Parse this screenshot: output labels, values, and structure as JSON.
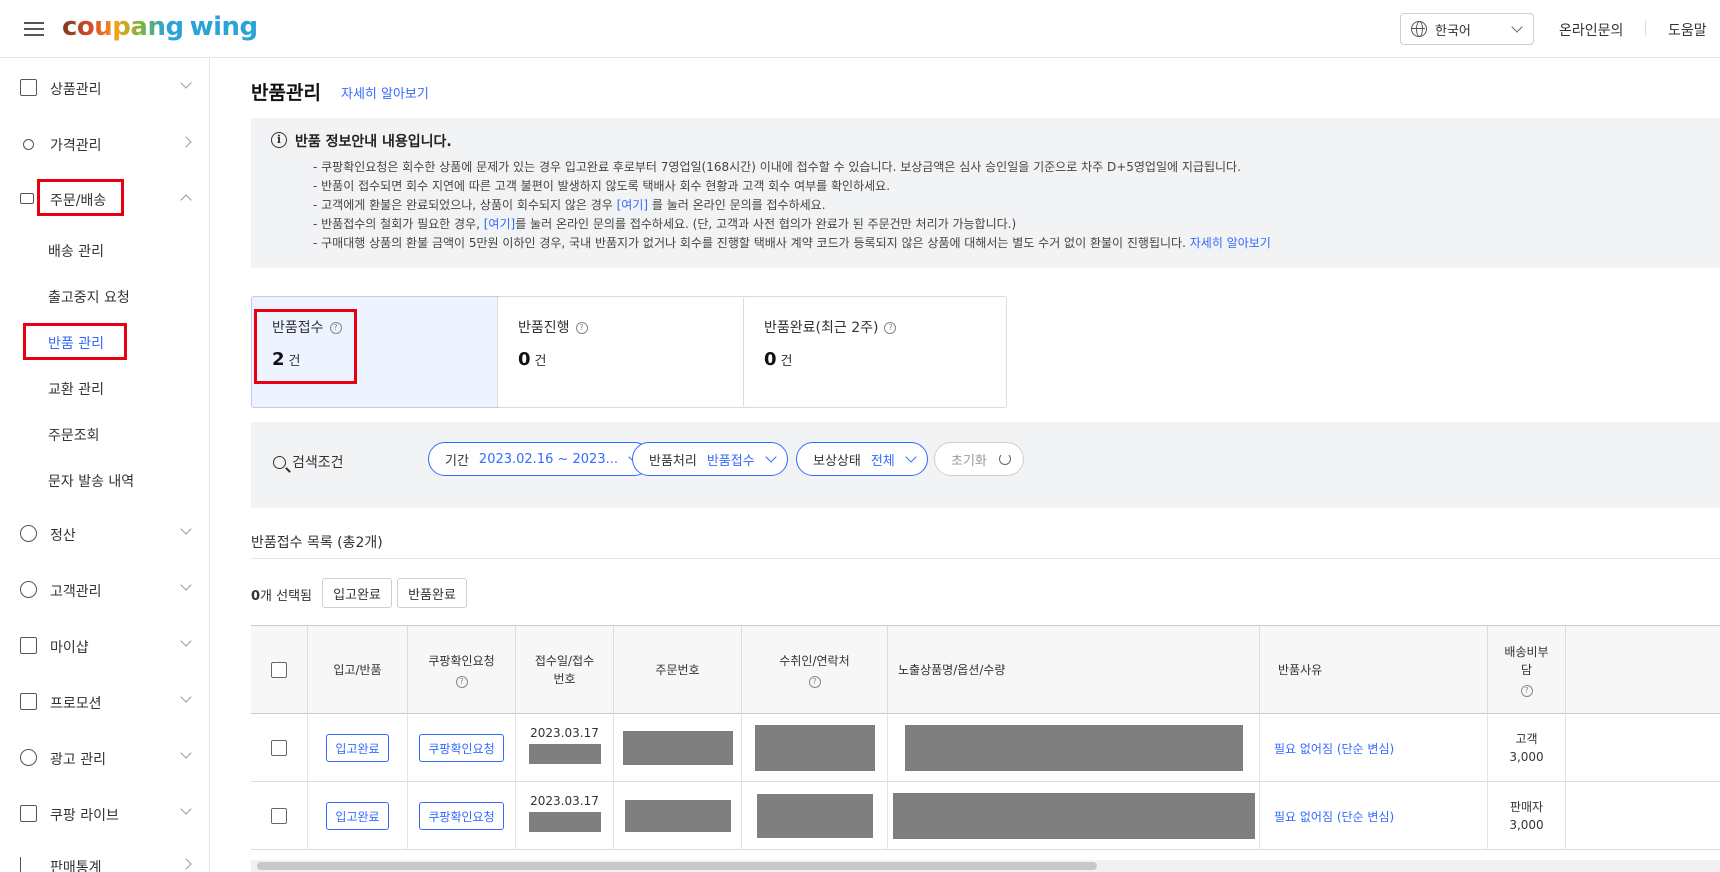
{
  "header": {
    "logo_text": "coupang",
    "logo_suffix": "wing",
    "language": "한국어",
    "links": [
      "온라인문의",
      "도움말"
    ]
  },
  "sidebar": {
    "items": [
      {
        "label": "상품관리",
        "icon": "box-icon"
      },
      {
        "label": "가격관리",
        "icon": "medal-icon"
      },
      {
        "label": "주문/배송",
        "icon": "truck-icon"
      },
      {
        "label": "정산",
        "icon": "won-icon"
      },
      {
        "label": "고객관리",
        "icon": "smile-icon"
      },
      {
        "label": "마이샵",
        "icon": "shop-icon"
      },
      {
        "label": "프로모션",
        "icon": "ticket-icon"
      },
      {
        "label": "광고 관리",
        "icon": "clock-icon"
      },
      {
        "label": "쿠팡 라이브",
        "icon": "live-icon"
      },
      {
        "label": "판매통계",
        "icon": "stats-icon"
      }
    ],
    "sub_items": [
      "배송 관리",
      "출고중지 요청",
      "반품 관리",
      "교환 관리",
      "주문조회",
      "문자 발송 내역"
    ]
  },
  "page": {
    "title": "반품관리",
    "learn_more": "자세히 알아보기"
  },
  "info": {
    "title": "반품 정보안내 내용입니다.",
    "lines": [
      {
        "pre": "- 쿠팡확인요청은 회수한 상품에 문제가 있는 경우 입고완료 후로부터 7영업일(168시간) 이내에 접수할 수 있습니다. 보상금액은 심사 승인일을 기준으로 차주 D+5영업일에 지급됩니다.",
        "link": "",
        "post": ""
      },
      {
        "pre": "- 반품이 접수되면 회수 지연에 따른 고객 불편이 발생하지 않도록 택배사 회수 현황과 고객 회수 여부를 확인하세요.",
        "link": "",
        "post": ""
      },
      {
        "pre": "- 고객에게 환불은 완료되었으나, 상품이 회수되지 않은 경우 ",
        "link": "[여기]",
        "post": " 를 눌러 온라인 문의를 접수하세요."
      },
      {
        "pre": "- 반품접수의 철회가 필요한 경우, ",
        "link": "[여기]",
        "post": "를 눌러 온라인 문의를 접수하세요. (단, 고객과 사전 협의가 완료가 된 주문건만 처리가 가능합니다.)"
      },
      {
        "pre": "- 구매대행 상품의 환불 금액이 5만원 이하인 경우, 국내 반품지가 없거나 회수를 진행할 택배사 계약 코드가 등록되지 않은 상품에 대해서는 별도 수거 없이 환불이 진행됩니다. ",
        "link": "자세히 알아보기",
        "post": ""
      }
    ]
  },
  "stats": [
    {
      "label": "반품접수",
      "count": "2",
      "unit": "건"
    },
    {
      "label": "반품진행",
      "count": "0",
      "unit": "건"
    },
    {
      "label": "반품완료(최근 2주)",
      "count": "0",
      "unit": "건"
    }
  ],
  "search": {
    "label": "검색조건",
    "filters": [
      {
        "name": "기간",
        "value": "2023.02.16 ~ 2023..."
      },
      {
        "name": "반품처리",
        "value": "반품접수"
      },
      {
        "name": "보상상태",
        "value": "전체"
      }
    ],
    "reset": "초기화"
  },
  "list": {
    "title": "반품접수 목록 (총2개)",
    "selected_count": "0",
    "selected_suffix": "개 선택됨",
    "actions": [
      "입고완료",
      "반품완료"
    ]
  },
  "table": {
    "headers": [
      "입고/반품",
      "쿠팡확인요청",
      "접수일/접수번호",
      "주문번호",
      "수취인/연락처",
      "노출상품명/옵션/수량",
      "반품사유",
      "배송비부담"
    ],
    "rows": [
      {
        "receive_btn": "입고완료",
        "confirm_btn": "쿠팡확인요청",
        "date": "2023.03.17",
        "reason": "필요 없어짐 (단순 변심)",
        "ship_payer": "고객",
        "ship_fee": "3,000"
      },
      {
        "receive_btn": "입고완료",
        "confirm_btn": "쿠팡확인요청",
        "date": "2023.03.17",
        "reason": "필요 없어짐 (단순 변심)",
        "ship_payer": "판매자",
        "ship_fee": "3,000"
      }
    ]
  },
  "colors": {
    "accent": "#346aff",
    "highlight": "#e60012",
    "redacted": "#7f7f7f"
  }
}
